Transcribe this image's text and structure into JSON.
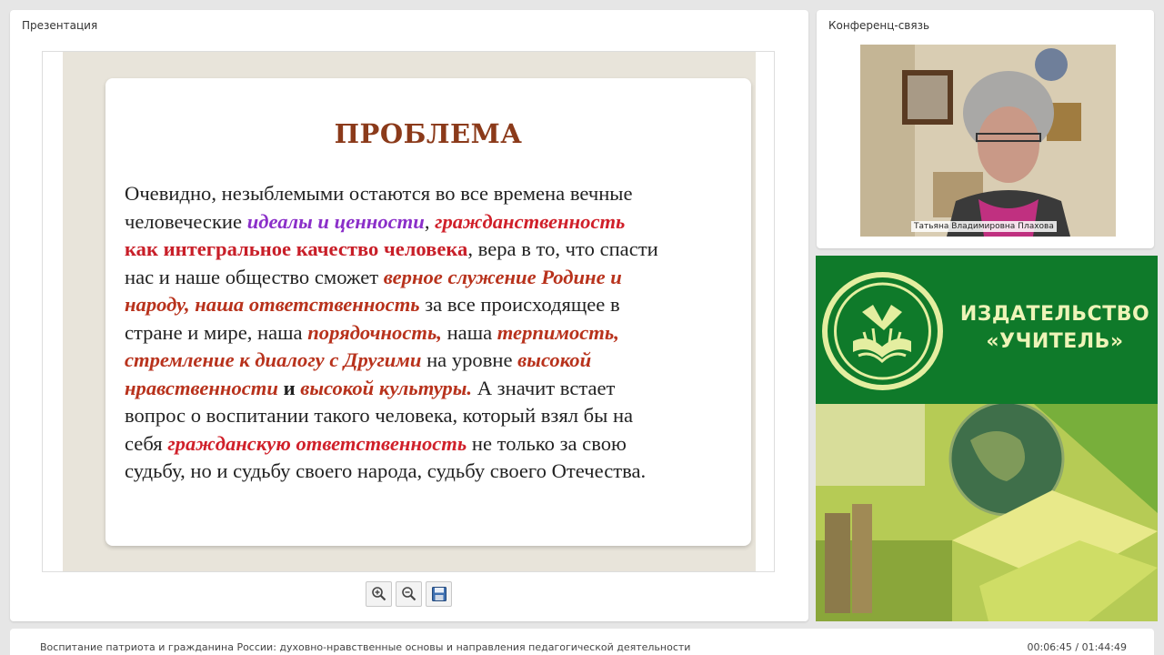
{
  "presentation": {
    "panel_title": "Презентация",
    "slide": {
      "title": "ПРОБЛЕМА",
      "lines": [
        [
          {
            "t": "Очевидно, незыблемыми остаются во все времена  вечные",
            "s": ""
          }
        ],
        [
          {
            "t": "человеческие ",
            "s": ""
          },
          {
            "t": "идеалы",
            "s": "hl-purple"
          },
          {
            "t": " и ",
            "s": "hl-purple"
          },
          {
            "t": "ценности",
            "s": "hl-purple"
          },
          {
            "t": ", ",
            "s": ""
          },
          {
            "t": "гражданственность",
            "s": "hl-red"
          }
        ],
        [
          {
            "t": "как интегральное качество человека",
            "s": "hl-redb"
          },
          {
            "t": ", вера в то, что спасти",
            "s": ""
          }
        ],
        [
          {
            "t": "нас и наше общество сможет ",
            "s": ""
          },
          {
            "t": "верное служение Родине и",
            "s": "hl-brown"
          }
        ],
        [
          {
            "t": "народу, наша ответственность",
            "s": "hl-brown"
          },
          {
            "t": " за все происходящее в",
            "s": ""
          }
        ],
        [
          {
            "t": "стране и мире, наша ",
            "s": ""
          },
          {
            "t": "порядочность,",
            "s": "hl-brown"
          },
          {
            "t": " наша ",
            "s": ""
          },
          {
            "t": "терпимость,",
            "s": "hl-brown"
          }
        ],
        [
          {
            "t": "стремление к диалогу с  Другими",
            "s": "hl-brown"
          },
          {
            "t": " на уровне ",
            "s": ""
          },
          {
            "t": "высокой",
            "s": "hl-brown"
          }
        ],
        [
          {
            "t": "нравственности",
            "s": "hl-brown"
          },
          {
            "t": " и ",
            "s": "bold"
          },
          {
            "t": "высокой культуры.",
            "s": "hl-brown"
          },
          {
            "t": " А значит встает",
            "s": ""
          }
        ],
        [
          {
            "t": "вопрос о воспитании такого человека, который взял бы на",
            "s": ""
          }
        ],
        [
          {
            "t": "себя ",
            "s": ""
          },
          {
            "t": "гражданскую ответственность",
            "s": "hl-red"
          },
          {
            "t": " не только за свою",
            "s": ""
          }
        ],
        [
          {
            "t": "судьбу, но и судьбу своего народа, судьбу своего Отечества.",
            "s": ""
          }
        ]
      ]
    },
    "toolbar": {
      "zoom_in_icon": "zoom-in-icon",
      "zoom_out_icon": "zoom-out-icon",
      "save_icon": "floppy-disk-icon"
    }
  },
  "conference": {
    "panel_title": "Конференц-связь",
    "participant_name": "Татьяна Владимировна Плахова"
  },
  "banner": {
    "line1": "ИЗДАТЕЛЬСТВО",
    "line2": "«УЧИТЕЛЬ»"
  },
  "footer": {
    "title": "Воспитание патриота и гражданина России: духовно-нравственные основы и направления педагогической деятельности",
    "time": "00:06:45 / 01:44:49"
  },
  "colors": {
    "slide_title": "#8b3a1a",
    "accent_purple": "#8b2fc9",
    "accent_red": "#d0202a",
    "accent_brown": "#b8321c",
    "banner_green": "#0f7a2a",
    "banner_text": "#eef4b8"
  }
}
